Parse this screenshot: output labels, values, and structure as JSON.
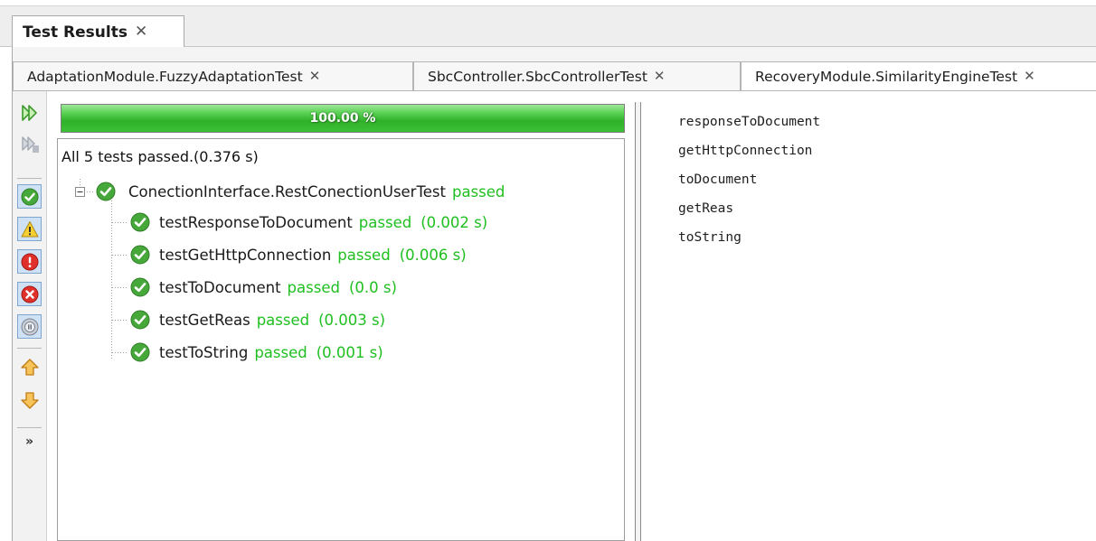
{
  "window": {
    "tab_label": "Test Results",
    "close_glyph": "✕"
  },
  "sub_tabs": [
    {
      "label": "AdaptationModule.FuzzyAdaptationTest",
      "close_glyph": "✕",
      "active": false
    },
    {
      "label": "SbcController.SbcControllerTest",
      "close_glyph": "✕",
      "active": false
    },
    {
      "label": "RecoveryModule.SimilarityEngineTest",
      "close_glyph": "✕",
      "active": true
    }
  ],
  "toolbar": {
    "buttons": [
      {
        "icon": "rerun-icon",
        "toggled": false
      },
      {
        "icon": "rerun-failed-icon",
        "toggled": false
      },
      {
        "icon": "show-passed-icon",
        "toggled": true
      },
      {
        "icon": "show-warnings-icon",
        "toggled": true
      },
      {
        "icon": "show-failures-icon",
        "toggled": true
      },
      {
        "icon": "show-errors-icon",
        "toggled": true
      },
      {
        "icon": "show-skipped-icon",
        "toggled": true
      },
      {
        "icon": "previous-failure-icon",
        "toggled": false
      },
      {
        "icon": "next-failure-icon",
        "toggled": false
      }
    ],
    "more_label": "»"
  },
  "progress": {
    "percent": 100,
    "label": "100.00 %"
  },
  "summary": "All 5 tests passed.(0.376 s)",
  "suite": {
    "name": "ConectionInterface.RestConectionUserTest",
    "status": "passed",
    "expanded": true
  },
  "tests": [
    {
      "name": "testResponseToDocument",
      "status": "passed",
      "time": "(0.002 s)"
    },
    {
      "name": "testGetHttpConnection",
      "status": "passed",
      "time": "(0.006 s)"
    },
    {
      "name": "testToDocument",
      "status": "passed",
      "time": "(0.0 s)"
    },
    {
      "name": "testGetReas",
      "status": "passed",
      "time": "(0.003 s)"
    },
    {
      "name": "testToString",
      "status": "passed",
      "time": "(0.001 s)"
    }
  ],
  "output_lines": [
    "responseToDocument",
    "getHttpConnection",
    "toDocument",
    "getReas",
    "toString"
  ],
  "colors": {
    "passed_text": "#1fbf1f",
    "progress_green": "#3cc136",
    "toggle_bg": "#cfe2f5"
  }
}
